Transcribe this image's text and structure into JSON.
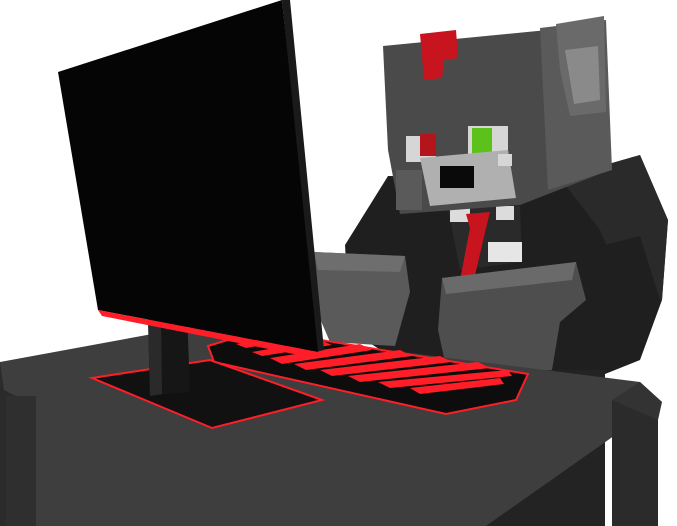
{
  "scene": {
    "background": "#ffffff",
    "colors": {
      "fur_dark": "#3a3a3a",
      "fur_mid": "#555555",
      "fur_light": "#8a8a8a",
      "suit": "#1e1e1e",
      "suit_highlight": "#2c2c2c",
      "accent_red": "#c8141e",
      "eye_green": "#5cc21a",
      "eye_white": "#d6d6d6",
      "desk_top": "#3c3c3c",
      "desk_side": "#2b2b2b",
      "monitor_screen": "#050505",
      "keyboard_glow": "#ff1e28"
    },
    "icons": [
      "wolf-character",
      "computer-monitor",
      "keyboard",
      "desk"
    ]
  }
}
